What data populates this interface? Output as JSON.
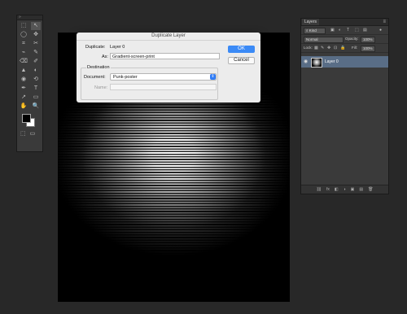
{
  "tools": {
    "header": "»",
    "items": [
      "⬚",
      "↖",
      "◯",
      "✥",
      "⌗",
      "✂",
      "⌁",
      "✎",
      "⌫",
      "✐",
      "▲",
      "◐",
      "◉",
      "⟲",
      "✒",
      "T",
      "↗",
      "▭",
      "✋",
      "🔍"
    ],
    "bottom": [
      "⬚",
      "▭"
    ]
  },
  "dialog": {
    "title": "Duplicate Layer",
    "duplicate_label": "Duplicate:",
    "duplicate_value": "Layer 0",
    "as_label": "As:",
    "as_value": "Gradient-screen-print",
    "destination_label": "Destination",
    "document_label": "Document:",
    "document_value": "Punk-poster",
    "name_label": "Name:",
    "name_value": "",
    "ok_label": "OK",
    "cancel_label": "Cancel"
  },
  "layers": {
    "tab": "Layers",
    "menu_icon": "≡",
    "filter_kind": "Kind",
    "blend_mode": "Normal",
    "opacity_label": "Opacity:",
    "opacity_value": "100%",
    "lock_label": "Lock:",
    "fill_label": "Fill:",
    "fill_value": "100%",
    "layer_name": "Layer 0",
    "footer_icons": [
      "⛓",
      "fx",
      "◧",
      "◑",
      "▣",
      "▤",
      "🗑"
    ]
  }
}
